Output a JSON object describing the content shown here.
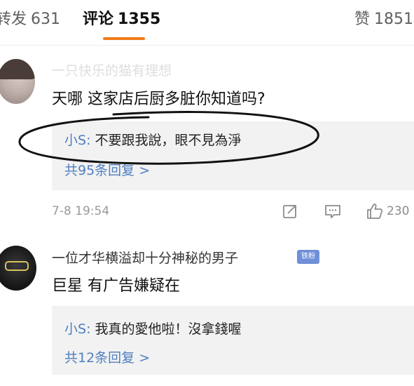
{
  "tabs": {
    "repost": {
      "label": "转发",
      "count": "631"
    },
    "comment": {
      "label": "评论",
      "count": "1355"
    },
    "like": {
      "label": "赞",
      "count": "1851"
    }
  },
  "colors": {
    "accent": "#f07a1a",
    "link": "#4f7fc0",
    "reply_bg": "#f2f2f2"
  },
  "comments": [
    {
      "username": "一只快乐的猫有理想",
      "text": "天哪 这家店后厨多脏你知道吗?",
      "reply": {
        "author": "小S",
        "separator": ": ",
        "text": "不要跟我說，眼不見為淨"
      },
      "reply_count": "共95条回复 >",
      "timestamp": "7-8 19:54",
      "like_count": "230"
    },
    {
      "username": "一位才华横溢却十分神秘的男子",
      "badge": "铁粉",
      "text": "巨星 有广告嫌疑在",
      "reply": {
        "author": "小S",
        "separator": ": ",
        "text": "我真的愛他啦！沒拿錢喔"
      },
      "reply_count": "共12条回复 >"
    }
  ],
  "icons": {
    "share": "share-icon",
    "comment": "comment-icon",
    "like": "thumbs-up-icon"
  }
}
